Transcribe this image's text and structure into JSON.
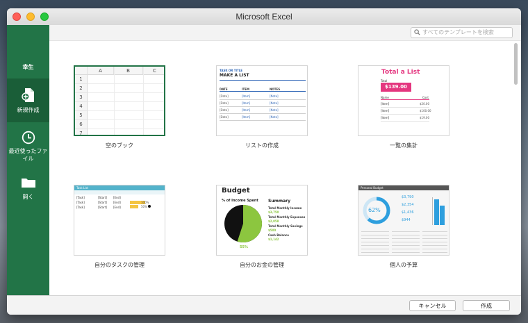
{
  "window": {
    "title": "Microsoft Excel"
  },
  "sidebar": {
    "items": [
      {
        "label": "幸生",
        "icon": "user-name",
        "active": false
      },
      {
        "label": "新規作成",
        "icon": "new-document-icon",
        "active": true
      },
      {
        "label": "最近使ったファイル",
        "icon": "clock-icon",
        "active": false
      },
      {
        "label": "開く",
        "icon": "folder-icon",
        "active": false
      }
    ]
  },
  "search": {
    "placeholder": "すべてのテンプレートを検索"
  },
  "templates": [
    {
      "label": "空のブック",
      "columns": [
        "A",
        "B",
        "C"
      ],
      "rows": [
        "1",
        "2",
        "3",
        "4",
        "5",
        "6",
        "7"
      ]
    },
    {
      "label": "リストの作成",
      "header_small": "TASK OR TITLE",
      "header_big": "MAKE A LIST",
      "cols": [
        "DATE",
        "ITEM",
        "NOTES"
      ],
      "cells": [
        "[Date]",
        "[Item]",
        "[Note]"
      ]
    },
    {
      "label": "一覧の集計",
      "title": "Total a List",
      "total_label": "Total",
      "total_value": "$139.00",
      "col_name": "Name",
      "col_cost": "Cost",
      "items": [
        {
          "name": "[Item]",
          "cost": "$20.00"
        },
        {
          "name": "[Item]",
          "cost": "$100.00"
        },
        {
          "name": "[Item]",
          "cost": "$19.00"
        }
      ]
    },
    {
      "label": "自分のタスクの管理",
      "header": "Task List",
      "cells": [
        "[Task]",
        "[Start]",
        "[End]"
      ],
      "percent": "100%",
      "percent2": "50%"
    },
    {
      "label": "自分のお金の管理",
      "title": "Budget",
      "pie_title": "% of Income Spent",
      "pie_percent": "55%",
      "pie_percent_value": 55,
      "summary_title": "Summary",
      "summary": [
        {
          "label": "Total Monthly Income",
          "value": "$3,750"
        },
        {
          "label": "Total Monthly Expenses",
          "value": "$2,058"
        },
        {
          "label": "Total Monthly Savings",
          "value": "$500"
        },
        {
          "label": "Cash Balance",
          "value": "$1,142"
        }
      ]
    },
    {
      "label": "個人の予算",
      "header": "Personal Budget",
      "ring_percent": "62%",
      "ring_value": 62,
      "figures": [
        "$3,790",
        "$2,354",
        "$1,436",
        "$944"
      ]
    }
  ],
  "footer": {
    "cancel": "キャンセル",
    "create": "作成"
  },
  "colors": {
    "excel_green": "#227447",
    "sidebar_active": "#1a5e38",
    "accent_pink": "#e4367f",
    "budget_green": "#8cc63f",
    "budget_blue": "#2e9fde"
  }
}
